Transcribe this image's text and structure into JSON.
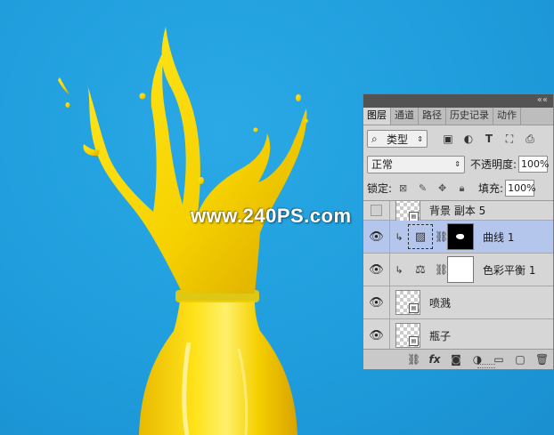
{
  "watermark": "www.240PS.com",
  "panel": {
    "tabs": [
      {
        "label": "图层",
        "active": true
      },
      {
        "label": "通道",
        "active": false
      },
      {
        "label": "路径",
        "active": false
      },
      {
        "label": "历史记录",
        "active": false
      },
      {
        "label": "动作",
        "active": false
      }
    ],
    "filter_label": "类型",
    "filter_icons": [
      "image-filter-icon",
      "adjustment-filter-icon",
      "type-filter-icon",
      "shape-filter-icon",
      "smart-object-filter-icon"
    ],
    "blend_mode": "正常",
    "opacity_label": "不透明度:",
    "opacity_value": "100%",
    "lock_label": "锁定:",
    "fill_label": "填充:",
    "fill_value": "100%",
    "layers": [
      {
        "name": "背景 副本 5",
        "visible": false,
        "type": "smart-object"
      },
      {
        "name": "曲线 1",
        "visible": true,
        "type": "curves",
        "clipped": true,
        "selected": true,
        "mask": "black"
      },
      {
        "name": "色彩平衡 1",
        "visible": true,
        "type": "color-balance",
        "clipped": true,
        "mask": "white"
      },
      {
        "name": "喷溅",
        "visible": true,
        "type": "smart-object"
      },
      {
        "name": "瓶子",
        "visible": true,
        "type": "smart-object"
      }
    ],
    "footer_icons": [
      "link-layers-icon",
      "fx-icon",
      "add-mask-icon",
      "new-adjustment-icon",
      "new-group-icon",
      "new-layer-icon",
      "delete-layer-icon"
    ]
  },
  "colors": {
    "background": "#1f9ddc",
    "paint": "#f7d800",
    "paint_shadow": "#d9a600",
    "selection": "#b5c6ec"
  }
}
